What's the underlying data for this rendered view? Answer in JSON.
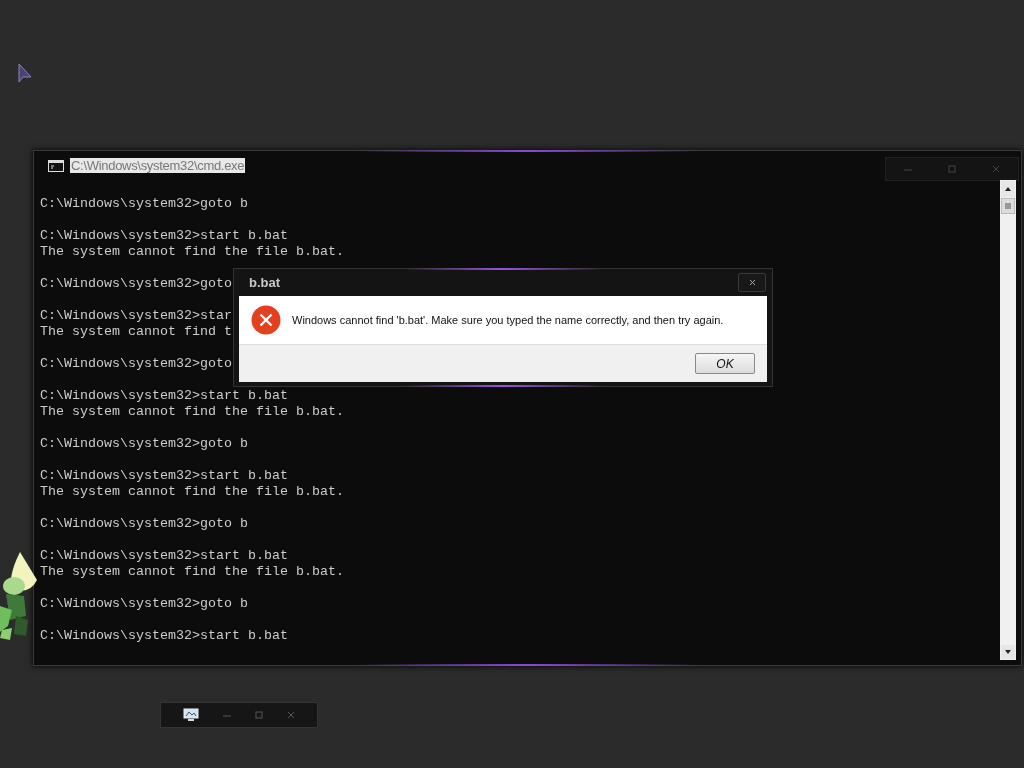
{
  "cmd_window": {
    "title": "C:\\Windows\\system32\\cmd.exe",
    "title_selected": true,
    "blocks": [
      [
        "C:\\Windows\\system32>goto b"
      ],
      [
        "C:\\Windows\\system32>start b.bat",
        "The system cannot find the file b.bat."
      ],
      [
        "C:\\Windows\\system32>goto"
      ],
      [
        "C:\\Windows\\system32>star",
        "The system cannot find t"
      ],
      [
        "C:\\Windows\\system32>goto"
      ],
      [
        "C:\\Windows\\system32>start b.bat",
        "The system cannot find the file b.bat."
      ],
      [
        "C:\\Windows\\system32>goto b"
      ],
      [
        "C:\\Windows\\system32>start b.bat",
        "The system cannot find the file b.bat."
      ],
      [
        "C:\\Windows\\system32>goto b"
      ],
      [
        "C:\\Windows\\system32>start b.bat",
        "The system cannot find the file b.bat."
      ],
      [
        "C:\\Windows\\system32>goto b"
      ],
      [
        "C:\\Windows\\system32>start b.bat"
      ]
    ]
  },
  "dialog": {
    "title": "b.bat",
    "message": "Windows cannot find 'b.bat'. Make sure you typed the name correctly, and then try again.",
    "buttons": [
      "OK"
    ]
  }
}
